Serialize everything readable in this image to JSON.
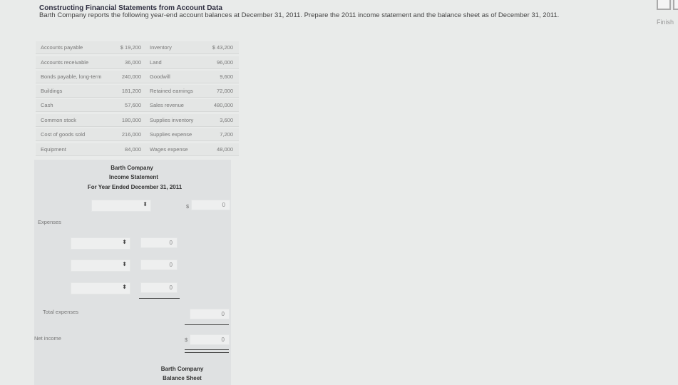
{
  "header": {
    "title": "Constructing Financial Statements from Account Data",
    "description": "Barth Company reports the following year-end account balances at December 31, 2011. Prepare the 2011 income statement and the balance sheet as of December 31, 2011.",
    "finish_label": "Finish"
  },
  "accounts": [
    {
      "name1": "Accounts payable",
      "amt1": "$ 19,200",
      "name2": "Inventory",
      "amt2": "$ 43,200"
    },
    {
      "name1": "Accounts receivable",
      "amt1": "36,000",
      "name2": "Land",
      "amt2": "96,000"
    },
    {
      "name1": "Bonds payable, long-term",
      "amt1": "240,000",
      "name2": "Goodwill",
      "amt2": "9,600"
    },
    {
      "name1": "Buildings",
      "amt1": "181,200",
      "name2": "Retained earnings",
      "amt2": "72,000"
    },
    {
      "name1": "Cash",
      "amt1": "57,600",
      "name2": "Sales revenue",
      "amt2": "480,000"
    },
    {
      "name1": "Common stock",
      "amt1": "180,000",
      "name2": "Supplies inventory",
      "amt2": "3,600"
    },
    {
      "name1": "Cost of goods sold",
      "amt1": "216,000",
      "name2": "Supplies expense",
      "amt2": "7,200"
    },
    {
      "name1": "Equipment",
      "amt1": "84,000",
      "name2": "Wages expense",
      "amt2": "48,000"
    }
  ],
  "income_statement": {
    "company": "Barth Company",
    "title": "Income Statement",
    "period": "For Year Ended December 31, 2011",
    "revenue_dollar": "$",
    "revenue_value": "0",
    "expenses_label": "Expenses",
    "expense_values": [
      "0",
      "0",
      "0"
    ],
    "total_expenses_label": "Total expenses",
    "total_expenses_value": "0",
    "net_income_label": "Net income",
    "net_income_dollar": "$",
    "net_income_value": "0",
    "select_arrow": "⬍"
  },
  "balance_sheet": {
    "company": "Barth Company",
    "title": "Balance Sheet"
  }
}
